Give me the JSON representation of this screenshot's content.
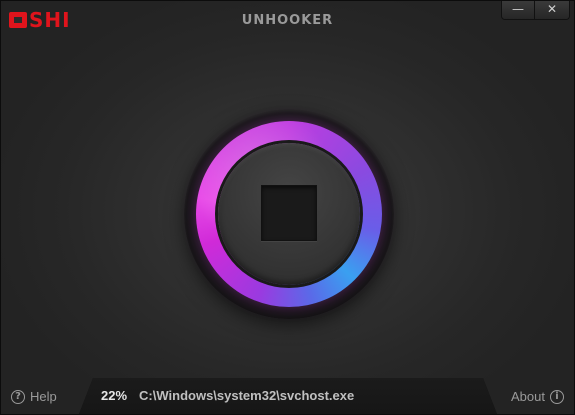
{
  "app": {
    "logo_text": "OSHI",
    "logo_suffix": "SHI",
    "title": "UNHOOKER"
  },
  "window_controls": {
    "minimize_label": "—",
    "close_label": "✕"
  },
  "scan": {
    "progress_percent_label": "22%",
    "progress": 0.22,
    "current_file": "C:\\Windows\\system32\\svchost.exe"
  },
  "footer": {
    "help_label": "Help",
    "help_icon_glyph": "?",
    "about_label": "About",
    "about_icon_glyph": "i"
  },
  "colors": {
    "brand_red": "#e0141c",
    "ring_magenta": "#d02ad8",
    "ring_blue": "#3aa0f0"
  }
}
